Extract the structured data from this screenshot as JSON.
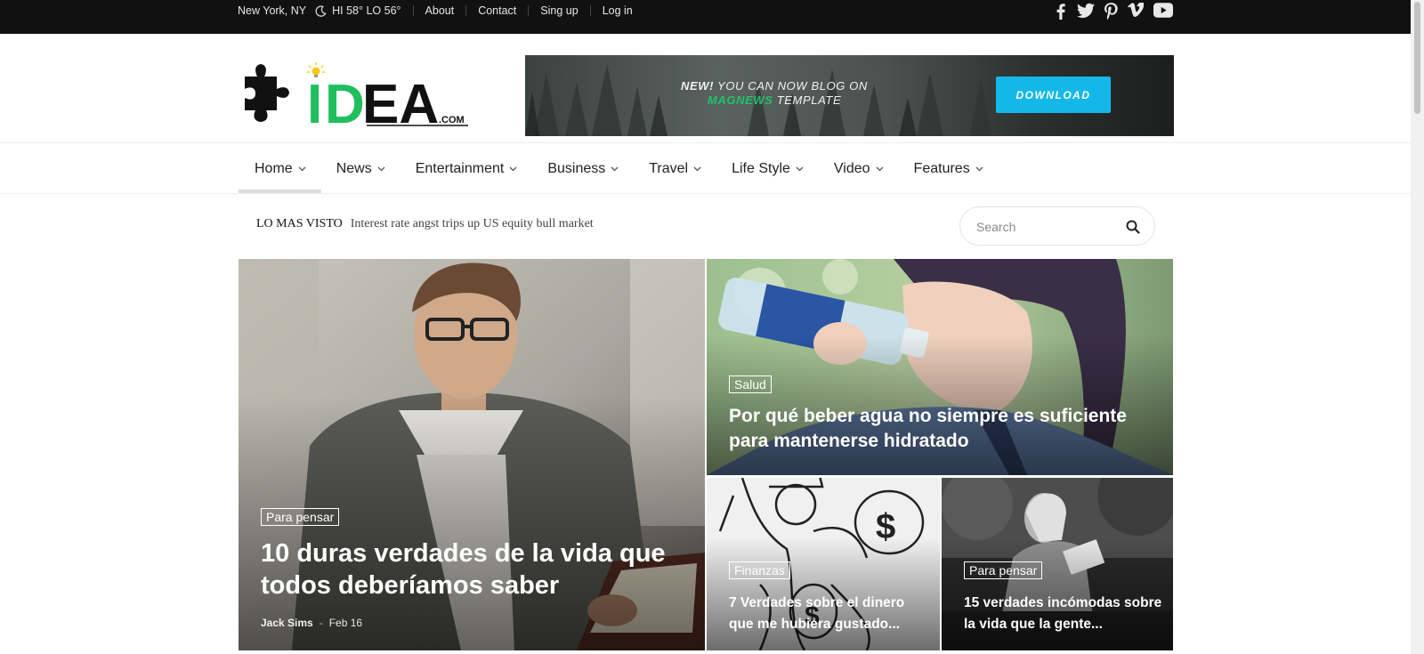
{
  "topbar": {
    "location": "New York, NY",
    "weather": "HI 58° LO 56°",
    "links": [
      "About",
      "Contact",
      "Sing up",
      "Log in"
    ],
    "social_icons": [
      "facebook-icon",
      "twitter-icon",
      "pinterest-icon",
      "vimeo-icon",
      "youtube-icon"
    ]
  },
  "logo": {
    "word": "IDEA",
    "suffix": ".COM"
  },
  "banner": {
    "new_label": "NEW!",
    "line1": "YOU CAN NOW BLOG ON",
    "brand": "MAGNEWS",
    "line2_rest": "TEMPLATE",
    "button": "DOWNLOAD"
  },
  "nav": {
    "items": [
      "Home",
      "News",
      "Entertainment",
      "Business",
      "Travel",
      "Life Style",
      "Video",
      "Features"
    ],
    "active": "Home"
  },
  "ticker": {
    "label": "LO MAS VISTO",
    "headline": "Interest rate angst trips up US equity bull market"
  },
  "search": {
    "placeholder": "Search"
  },
  "featured": {
    "main": {
      "category": "Para pensar",
      "title": "10 duras verdades de la vida que todos deberíamos saber",
      "author": "Jack Sims",
      "date": "Feb 16"
    },
    "top_right": {
      "category": "Salud",
      "title": "Por qué beber agua no siempre es suficiente para mantenerse hidratado"
    },
    "bottom_left": {
      "category": "Finanzas",
      "title": "7 Verdades sobre el dinero que me hubiera gustado..."
    },
    "bottom_right": {
      "category": "Para pensar",
      "title": "15 verdades incómodas sobre la vida que la gente..."
    }
  },
  "colors": {
    "topbar_bg": "#111111",
    "brand_green": "#22c16b",
    "download_button": "#14b8e8"
  }
}
